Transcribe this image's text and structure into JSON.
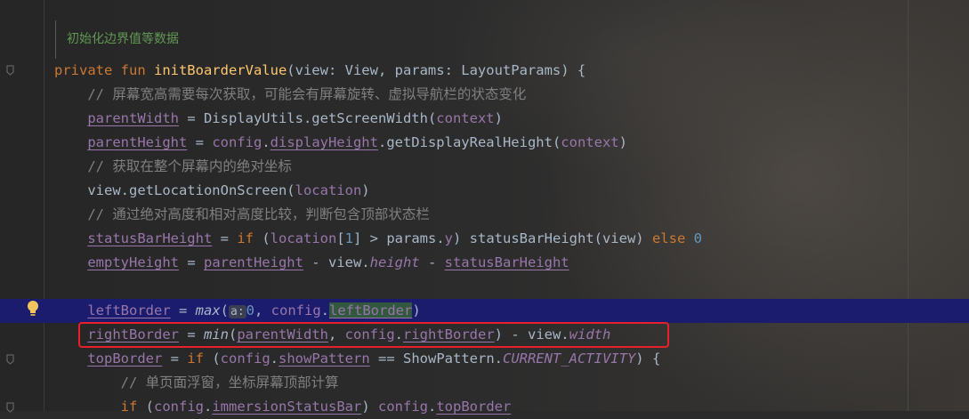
{
  "editor": {
    "doc_comment": "初始化边界值等数据",
    "hint_label": "a:",
    "lines": [
      {
        "t": [
          [
            "kw",
            "private fun "
          ],
          [
            "fn",
            "initBoarderValue"
          ],
          [
            "pl",
            "(view: View, params: LayoutParams) {"
          ]
        ]
      },
      {
        "t": [
          [
            "pl",
            "    "
          ],
          [
            "cm",
            "// 屏幕宽高需要每次获取，可能会有屏幕旋转、虚拟导航栏的状态变化"
          ]
        ]
      },
      {
        "t": [
          [
            "pl",
            "    "
          ],
          [
            "prop ul",
            "parentWidth"
          ],
          [
            "pl",
            " = DisplayUtils.getScreenWidth("
          ],
          [
            "prop",
            "context"
          ],
          [
            "pl",
            ")"
          ]
        ]
      },
      {
        "t": [
          [
            "pl",
            "    "
          ],
          [
            "prop ul",
            "parentHeight"
          ],
          [
            "pl",
            " = "
          ],
          [
            "prop",
            "config"
          ],
          [
            "pl",
            "."
          ],
          [
            "prop ul",
            "displayHeight"
          ],
          [
            "pl",
            ".getDisplayRealHeight("
          ],
          [
            "prop",
            "context"
          ],
          [
            "pl",
            ")"
          ]
        ]
      },
      {
        "t": [
          [
            "pl",
            "    "
          ],
          [
            "cm",
            "// 获取在整个屏幕内的绝对坐标"
          ]
        ]
      },
      {
        "t": [
          [
            "pl",
            "    view.getLocationOnScreen("
          ],
          [
            "prop",
            "location"
          ],
          [
            "pl",
            ")"
          ]
        ]
      },
      {
        "t": [
          [
            "pl",
            "    "
          ],
          [
            "cm",
            "// 通过绝对高度和相对高度比较，判断包含顶部状态栏"
          ]
        ]
      },
      {
        "t": [
          [
            "pl",
            "    "
          ],
          [
            "prop ul",
            "statusBarHeight"
          ],
          [
            "pl",
            " = "
          ],
          [
            "kw",
            "if "
          ],
          [
            "pl",
            "("
          ],
          [
            "prop",
            "location"
          ],
          [
            "pl",
            "["
          ],
          [
            "num",
            "1"
          ],
          [
            "pl",
            "] > params."
          ],
          [
            "prop",
            "y"
          ],
          [
            "pl",
            ") statusBarHeight(view) "
          ],
          [
            "kw",
            "else "
          ],
          [
            "num",
            "0"
          ]
        ]
      },
      {
        "t": [
          [
            "pl",
            "    "
          ],
          [
            "prop ul",
            "emptyHeight"
          ],
          [
            "pl",
            " = "
          ],
          [
            "prop ul",
            "parentHeight"
          ],
          [
            "pl",
            " - view."
          ],
          [
            "prop it",
            "height"
          ],
          [
            "pl",
            " - "
          ],
          [
            "prop ul",
            "statusBarHeight"
          ]
        ]
      },
      {
        "t": []
      },
      {
        "t": [
          [
            "pl",
            "    "
          ],
          [
            "prop ul",
            "leftBorder"
          ],
          [
            "pl",
            " = "
          ],
          [
            "pl it",
            "max"
          ],
          [
            "pl",
            "("
          ],
          [
            "hint",
            "a:"
          ],
          [
            "num",
            "0"
          ],
          [
            "pl",
            ", "
          ],
          [
            "prop",
            "config"
          ],
          [
            "pl",
            "."
          ],
          [
            "prop ul green-box",
            "leftBorder"
          ],
          [
            "pl",
            ")"
          ]
        ],
        "highlight": true
      },
      {
        "t": [
          [
            "pl",
            "    "
          ],
          [
            "prop ul",
            "rightBorder"
          ],
          [
            "pl",
            " = "
          ],
          [
            "pl it",
            "min"
          ],
          [
            "pl",
            "("
          ],
          [
            "prop ul",
            "parentWidth"
          ],
          [
            "pl",
            ", "
          ],
          [
            "prop",
            "config"
          ],
          [
            "pl",
            "."
          ],
          [
            "prop ul",
            "rightBorder"
          ],
          [
            "pl",
            ") - view."
          ],
          [
            "prop it",
            "width"
          ]
        ]
      },
      {
        "t": [
          [
            "pl",
            "    "
          ],
          [
            "prop ul",
            "topBorder"
          ],
          [
            "pl",
            " = "
          ],
          [
            "kw",
            "if "
          ],
          [
            "pl",
            "("
          ],
          [
            "prop",
            "config"
          ],
          [
            "pl",
            "."
          ],
          [
            "prop ul",
            "showPattern"
          ],
          [
            "pl",
            " == ShowPattern."
          ],
          [
            "prop it",
            "CURRENT_ACTIVITY"
          ],
          [
            "pl",
            ") {"
          ]
        ]
      },
      {
        "t": [
          [
            "pl",
            "        "
          ],
          [
            "cm",
            "// 单页面浮窗，坐标屏幕顶部计算"
          ]
        ]
      },
      {
        "t": [
          [
            "pl",
            "        "
          ],
          [
            "kw",
            "if "
          ],
          [
            "pl",
            "("
          ],
          [
            "prop",
            "config"
          ],
          [
            "pl",
            "."
          ],
          [
            "prop ul",
            "immersionStatusBar"
          ],
          [
            "pl",
            ") "
          ],
          [
            "prop",
            "config"
          ],
          [
            "pl",
            "."
          ],
          [
            "prop ul",
            "topBorder"
          ]
        ]
      }
    ]
  }
}
